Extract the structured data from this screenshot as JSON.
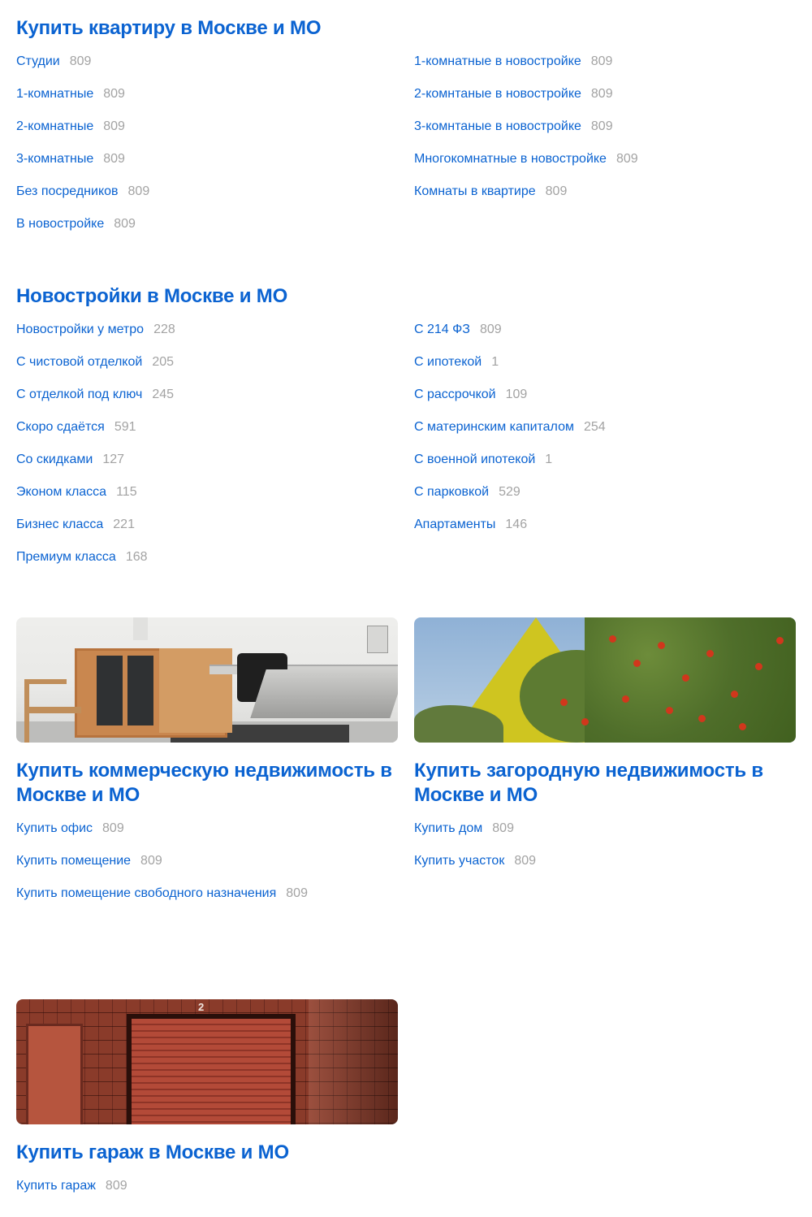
{
  "apartments": {
    "title": "Купить квартиру в Москве и МО",
    "left": [
      {
        "label": "Студии",
        "count": "809"
      },
      {
        "label": "1-комнатные",
        "count": "809"
      },
      {
        "label": "2-комнатные",
        "count": "809"
      },
      {
        "label": "3-комнатные",
        "count": "809"
      },
      {
        "label": "Без посредников",
        "count": "809"
      },
      {
        "label": "В новостройке",
        "count": "809"
      }
    ],
    "right": [
      {
        "label": "1-комнатные в новостройке",
        "count": "809"
      },
      {
        "label": "2-комнтаные в новостройке",
        "count": "809"
      },
      {
        "label": "3-комнтаные в новостройке",
        "count": "809"
      },
      {
        "label": "Многокомнатные в новостройке",
        "count": "809"
      },
      {
        "label": "Комнаты в квартире",
        "count": "809"
      }
    ]
  },
  "newbuildings": {
    "title": "Новостройки в Москве и МО",
    "left": [
      {
        "label": "Новостройки у метро",
        "count": "228"
      },
      {
        "label": "С чистовой отделкой",
        "count": "205"
      },
      {
        "label": "С отделкой под ключ",
        "count": "245"
      },
      {
        "label": "Скоро сдаётся",
        "count": "591"
      },
      {
        "label": "Со скидками",
        "count": "127"
      },
      {
        "label": "Эконом класса",
        "count": "115"
      },
      {
        "label": "Бизнес класса",
        "count": "221"
      },
      {
        "label": "Премиум класса",
        "count": "168"
      }
    ],
    "right": [
      {
        "label": "С 214 ФЗ",
        "count": "809"
      },
      {
        "label": "С ипотекой",
        "count": "1"
      },
      {
        "label": "С рассрочкой",
        "count": "109"
      },
      {
        "label": "С материнским капиталом",
        "count": "254"
      },
      {
        "label": "С военной ипотекой",
        "count": "1"
      },
      {
        "label": "С парковкой",
        "count": "529"
      },
      {
        "label": "Апартаменты",
        "count": "146"
      }
    ]
  },
  "commercial": {
    "title": "Купить коммерческую недвижимость в Москве и МО",
    "items": [
      {
        "label": "Купить офис",
        "count": "809"
      },
      {
        "label": "Купить помещение",
        "count": "809"
      },
      {
        "label": "Купить помещение свободного назначения",
        "count": "809"
      }
    ]
  },
  "country": {
    "title": "Купить загородную недвижимость в Москве и МО",
    "items": [
      {
        "label": "Купить дом",
        "count": "809"
      },
      {
        "label": "Купить участок",
        "count": "809"
      }
    ]
  },
  "garage": {
    "title": "Купить гараж в Москве и МО",
    "image_number": "2",
    "items": [
      {
        "label": "Купить гараж",
        "count": "809"
      }
    ]
  },
  "colors": {
    "link": "#0b63d1",
    "count": "#a3a3a3"
  }
}
